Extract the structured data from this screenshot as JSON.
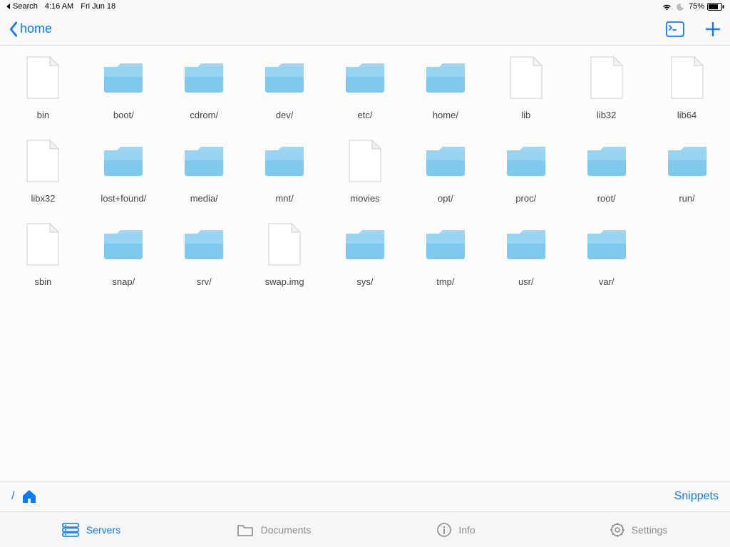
{
  "status_bar": {
    "back_app": "Search",
    "time": "4:16 AM",
    "date": "Fri Jun 18",
    "battery_pct": "75%"
  },
  "nav": {
    "back_label": "home"
  },
  "files": [
    {
      "name": "bin",
      "type": "file"
    },
    {
      "name": "boot/",
      "type": "folder"
    },
    {
      "name": "cdrom/",
      "type": "folder"
    },
    {
      "name": "dev/",
      "type": "folder"
    },
    {
      "name": "etc/",
      "type": "folder"
    },
    {
      "name": "home/",
      "type": "folder"
    },
    {
      "name": "lib",
      "type": "file"
    },
    {
      "name": "lib32",
      "type": "file"
    },
    {
      "name": "lib64",
      "type": "file"
    },
    {
      "name": "libx32",
      "type": "file"
    },
    {
      "name": "lost+found/",
      "type": "folder"
    },
    {
      "name": "media/",
      "type": "folder"
    },
    {
      "name": "mnt/",
      "type": "folder"
    },
    {
      "name": "movies",
      "type": "file"
    },
    {
      "name": "opt/",
      "type": "folder"
    },
    {
      "name": "proc/",
      "type": "folder"
    },
    {
      "name": "root/",
      "type": "folder"
    },
    {
      "name": "run/",
      "type": "folder"
    },
    {
      "name": "sbin",
      "type": "file"
    },
    {
      "name": "snap/",
      "type": "folder"
    },
    {
      "name": "srv/",
      "type": "folder"
    },
    {
      "name": "swap.img",
      "type": "file"
    },
    {
      "name": "sys/",
      "type": "folder"
    },
    {
      "name": "tmp/",
      "type": "folder"
    },
    {
      "name": "usr/",
      "type": "folder"
    },
    {
      "name": "var/",
      "type": "folder"
    }
  ],
  "breadcrumb": {
    "root": "/",
    "snippets_label": "Snippets"
  },
  "tabs": {
    "servers": "Servers",
    "documents": "Documents",
    "info": "Info",
    "settings": "Settings"
  }
}
